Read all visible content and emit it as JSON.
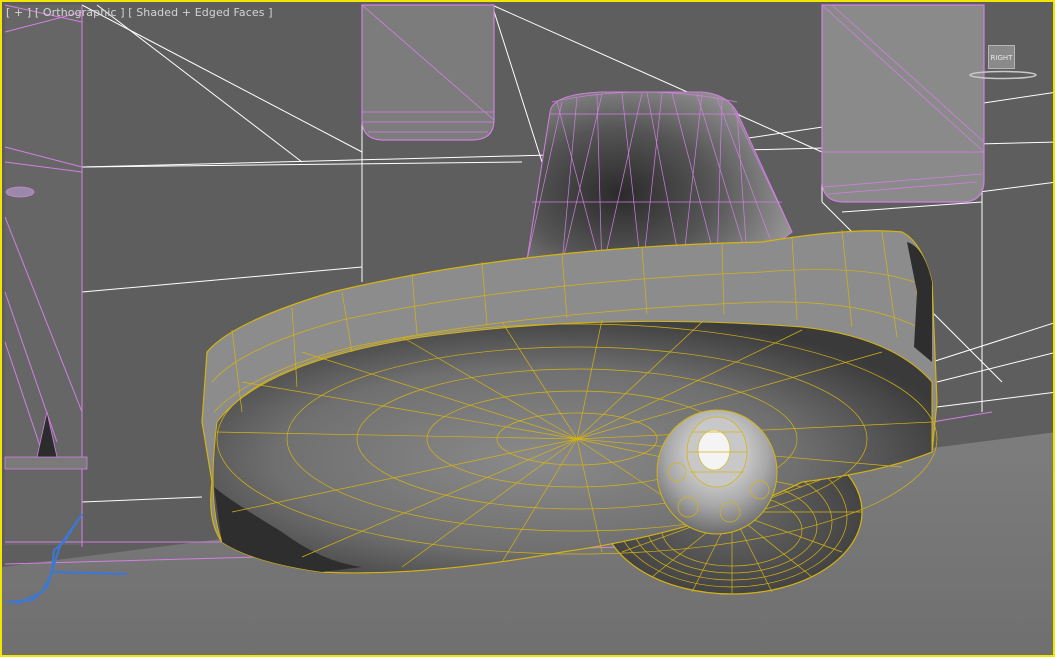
{
  "viewport": {
    "label_plus": "[ + ]",
    "label_view": "[ Orthographic ]",
    "label_shading": "[ Shaded + Edged Faces ]",
    "active_border_color": "#f2e600"
  },
  "viewcube": {
    "face_label": "RIGHT"
  },
  "colors": {
    "background": "#5c5c5c",
    "floor": "#7a7a7a",
    "selected_wire": "#d4b414",
    "pink_wire": "#d080e0",
    "white_wire": "#ffffff",
    "blue_curve": "#3a78d8"
  },
  "icons": [
    "viewcube-icon"
  ]
}
